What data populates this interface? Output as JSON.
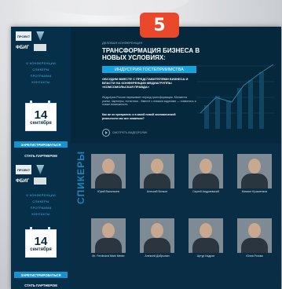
{
  "badge": {
    "number": "5"
  },
  "sidebar": {
    "top_logos": [
      "ПРОЕКТ",
      "ФБИГ",
      "ТИКОВ"
    ],
    "links": [
      "О КОНФЕРЕНЦИИ",
      "СПИКЕРЫ",
      "ПРОГРАММА",
      "КОНТАКТЫ"
    ],
    "date_day": "14",
    "date_month": "сентября",
    "register_label": "ЗАРЕГИСТРИРОВАТЬСЯ",
    "partner_label": "СТАТЬ ПАРТНЕРОМ"
  },
  "main": {
    "conf_label": "ДЕЛОВАЯ КОНФЕРЕНЦИЯ",
    "headline": "ТРАНСФОРМАЦИЯ БИЗНЕСА В НОВЫХ УСЛОВИЯХ:",
    "tag": "ИНДУСТРИЯ ГОСТЕПРИИМСТВА",
    "subhead": "ОБСУДИМ ВМЕСТЕ С ПРЕДСТАВИТЕЛЯМИ БИЗНЕСА И ВЛАСТИ НА КОНФЕРЕНЦИИ МЕДИАГРУППЫ «КОМСОМОЛЬСКАЯ ПРАВДА»",
    "paragraph": "Индустрия России переживает период трансформации. Меняются рынки, партнеры, логистика... Вместе с новыми задачами — появились и новые возможности.",
    "question": "Как же их превратить и в какой новой экономической реальности мы все окажемся?",
    "play_label": "СМОТРЕТЬ ВИДЕОРОЛИК"
  },
  "speakers": {
    "title": "СПИКЕРЫ",
    "people": [
      {
        "name": "Юрий Васильчев"
      },
      {
        "name": "Алексей Волков"
      },
      {
        "name": "Сергей Андриевский"
      },
      {
        "name": "Михаил Кузьменков"
      },
      {
        "name": "Mr. Ferdinand Mark Meder"
      },
      {
        "name": "Алексей Добрынин"
      },
      {
        "name": "Артур Кадров"
      },
      {
        "name": "Юлия Рогова"
      }
    ]
  },
  "colors": {
    "badge": "#e9482b",
    "page_dark": "#06283d",
    "accent_blue": "#17a2dc"
  }
}
